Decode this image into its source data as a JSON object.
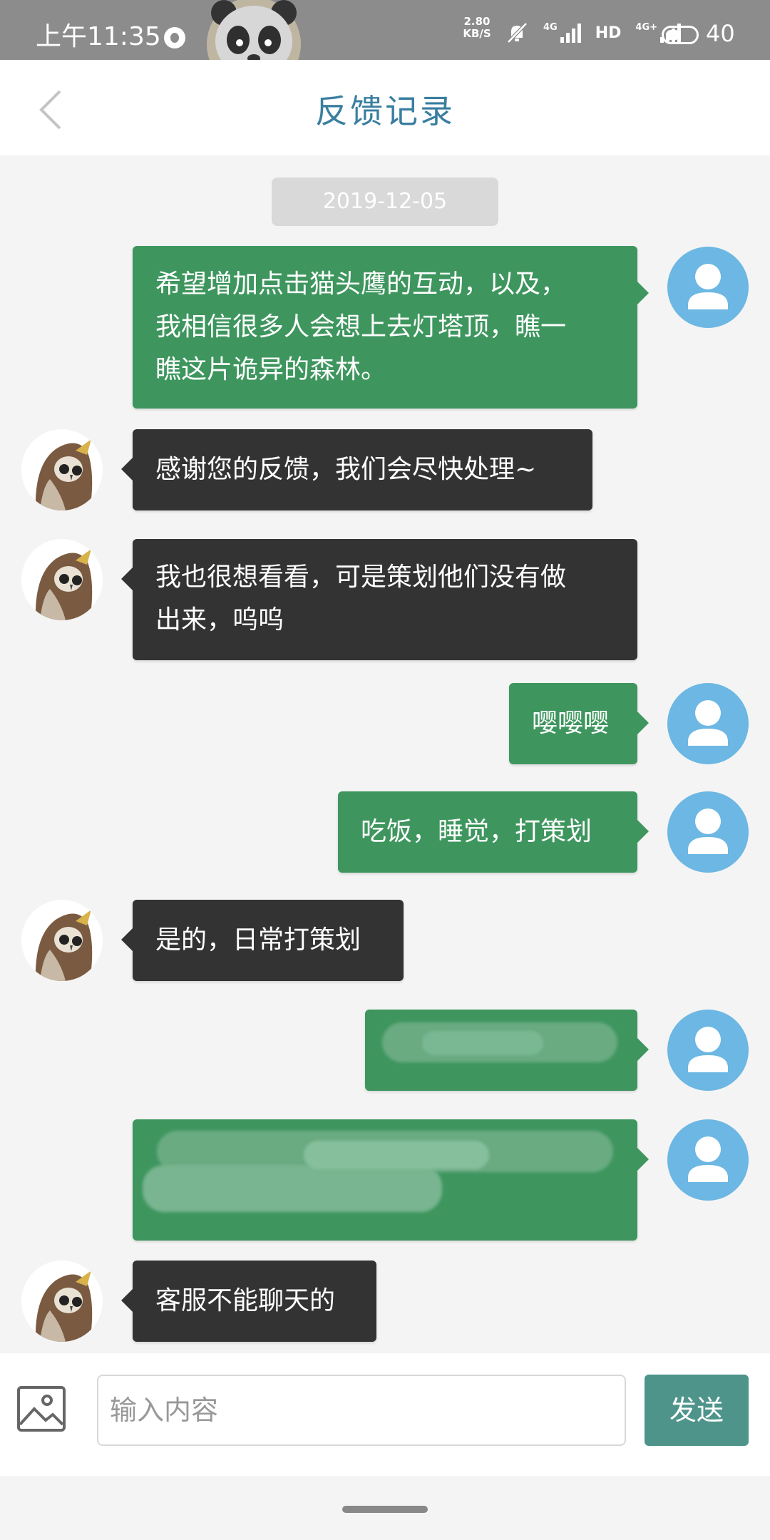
{
  "status_bar": {
    "time": "上午11:35",
    "net_speed_value": "2.80",
    "net_speed_unit": "KB/S",
    "signal_1": "4G",
    "hd": "HD",
    "signal_2": "4G+",
    "battery": "40"
  },
  "header": {
    "title": "反馈记录"
  },
  "date_divider": "2019-12-05",
  "messages": [
    {
      "sender": "user",
      "text": "希望增加点击猫头鹰的互动，以及，\n我相信很多人会想上去灯塔顶，瞧一\n瞧这片诡异的森林。"
    },
    {
      "sender": "support",
      "text": "感谢您的反馈，我们会尽快处理~"
    },
    {
      "sender": "support",
      "text": "我也很想看看，可是策划他们没有做\n出来，呜呜"
    },
    {
      "sender": "user",
      "text": "嘤嘤嘤"
    },
    {
      "sender": "user",
      "text": "吃饭，睡觉，打策划"
    },
    {
      "sender": "support",
      "text": "是的，日常打策划"
    },
    {
      "sender": "user",
      "text": ""
    },
    {
      "sender": "user",
      "text": ""
    },
    {
      "sender": "support",
      "text": "客服不能聊天的"
    }
  ],
  "composer": {
    "placeholder": "输入内容",
    "send_label": "发送"
  },
  "colors": {
    "user_bubble": "#3e965e",
    "support_bubble": "#333333",
    "title": "#3a7ea0",
    "send_button": "#4e948a",
    "user_avatar": "#6cb7e3"
  }
}
